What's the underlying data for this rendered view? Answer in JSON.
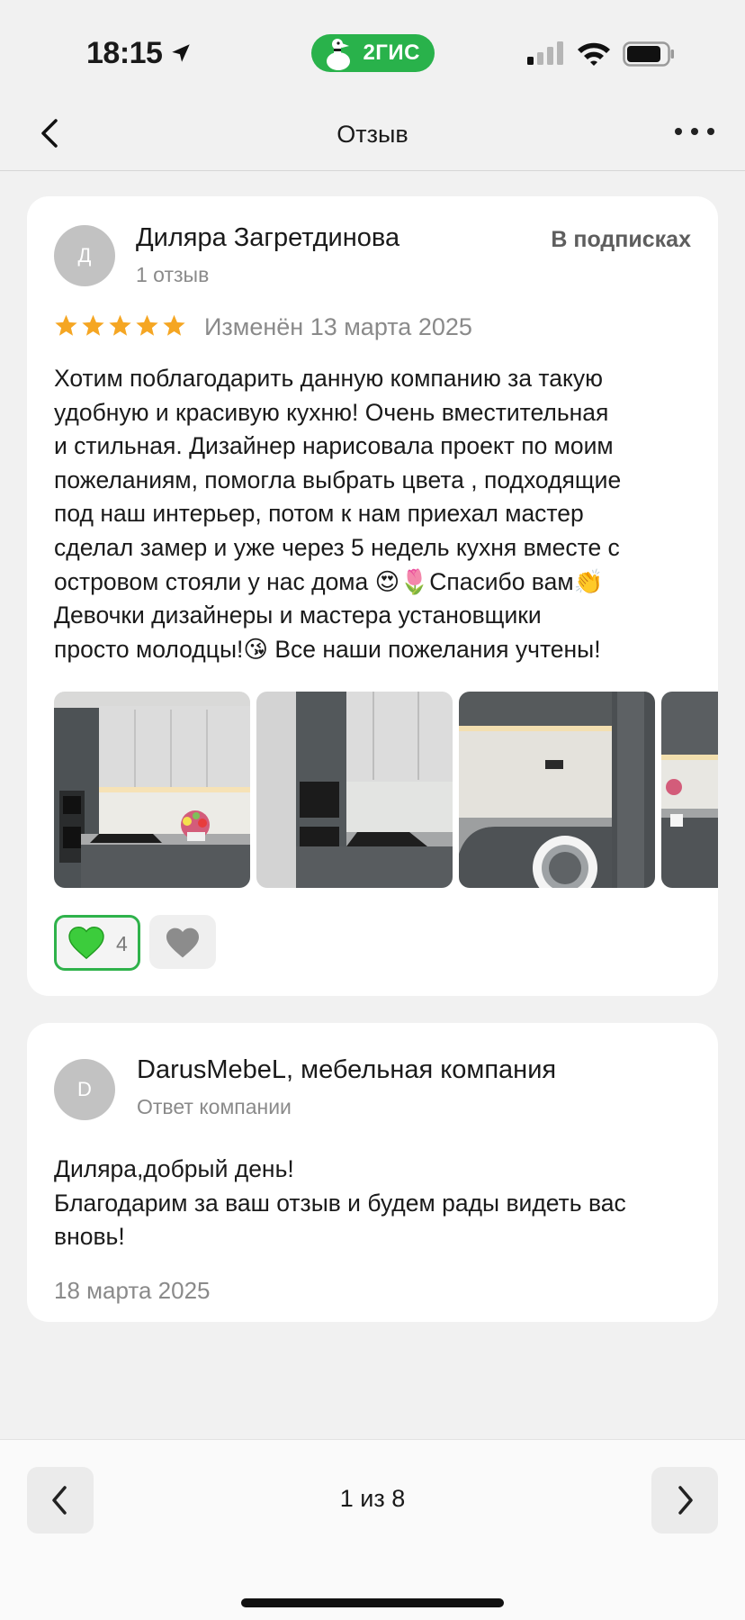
{
  "status_bar": {
    "time": "18:15",
    "app_badge": "2ГИС",
    "colors": {
      "badge": "#29b24b"
    }
  },
  "nav": {
    "title": "Отзыв",
    "back_icon": "chevron-left-icon",
    "more_icon": "more-horizontal-icon"
  },
  "review": {
    "avatar_initial": "Д",
    "author": "Диляра Загретдинова",
    "author_meta": "1 отзыв",
    "subscription_label": "В подписках",
    "rating": 5,
    "rating_max": 5,
    "edited": "Изменён 13 марта 2025",
    "text": "Хотим поблагодарить данную компанию за такую\nудобную и красивую кухню! Очень вместительная\nи стильная. Дизайнер нарисовала проект по моим\nпожеланиям, помогла выбрать цвета , подходящие\nпод наш интерьер, потом к нам приехал мастер\nсделал замер и уже через 5 недель кухня вместе с\nостровом стояли у нас дома 😍🌷Спасибо вам👏\nДевочки дизайнеры и мастера установщики\nпросто молодцы!😘 Все наши пожелания учтены!",
    "photos": [
      "kitchen-photo-1",
      "kitchen-photo-2",
      "kitchen-photo-3",
      "kitchen-photo-4"
    ],
    "likes": "4",
    "colors": {
      "star": "#f5a623",
      "like_border": "#2fb24b",
      "heart": "#3ccc3c"
    }
  },
  "reply": {
    "avatar_initial": "D",
    "company": "DarusMebeL, мебельная компания",
    "meta": "Ответ компании",
    "text": "Диляра,добрый день!\nБлагодарим за ваш отзыв и будем рады видеть вас\nвновь!",
    "date": "18 марта 2025"
  },
  "pagination": {
    "label": "1 из 8",
    "prev_icon": "chevron-left-icon",
    "next_icon": "chevron-right-icon"
  }
}
